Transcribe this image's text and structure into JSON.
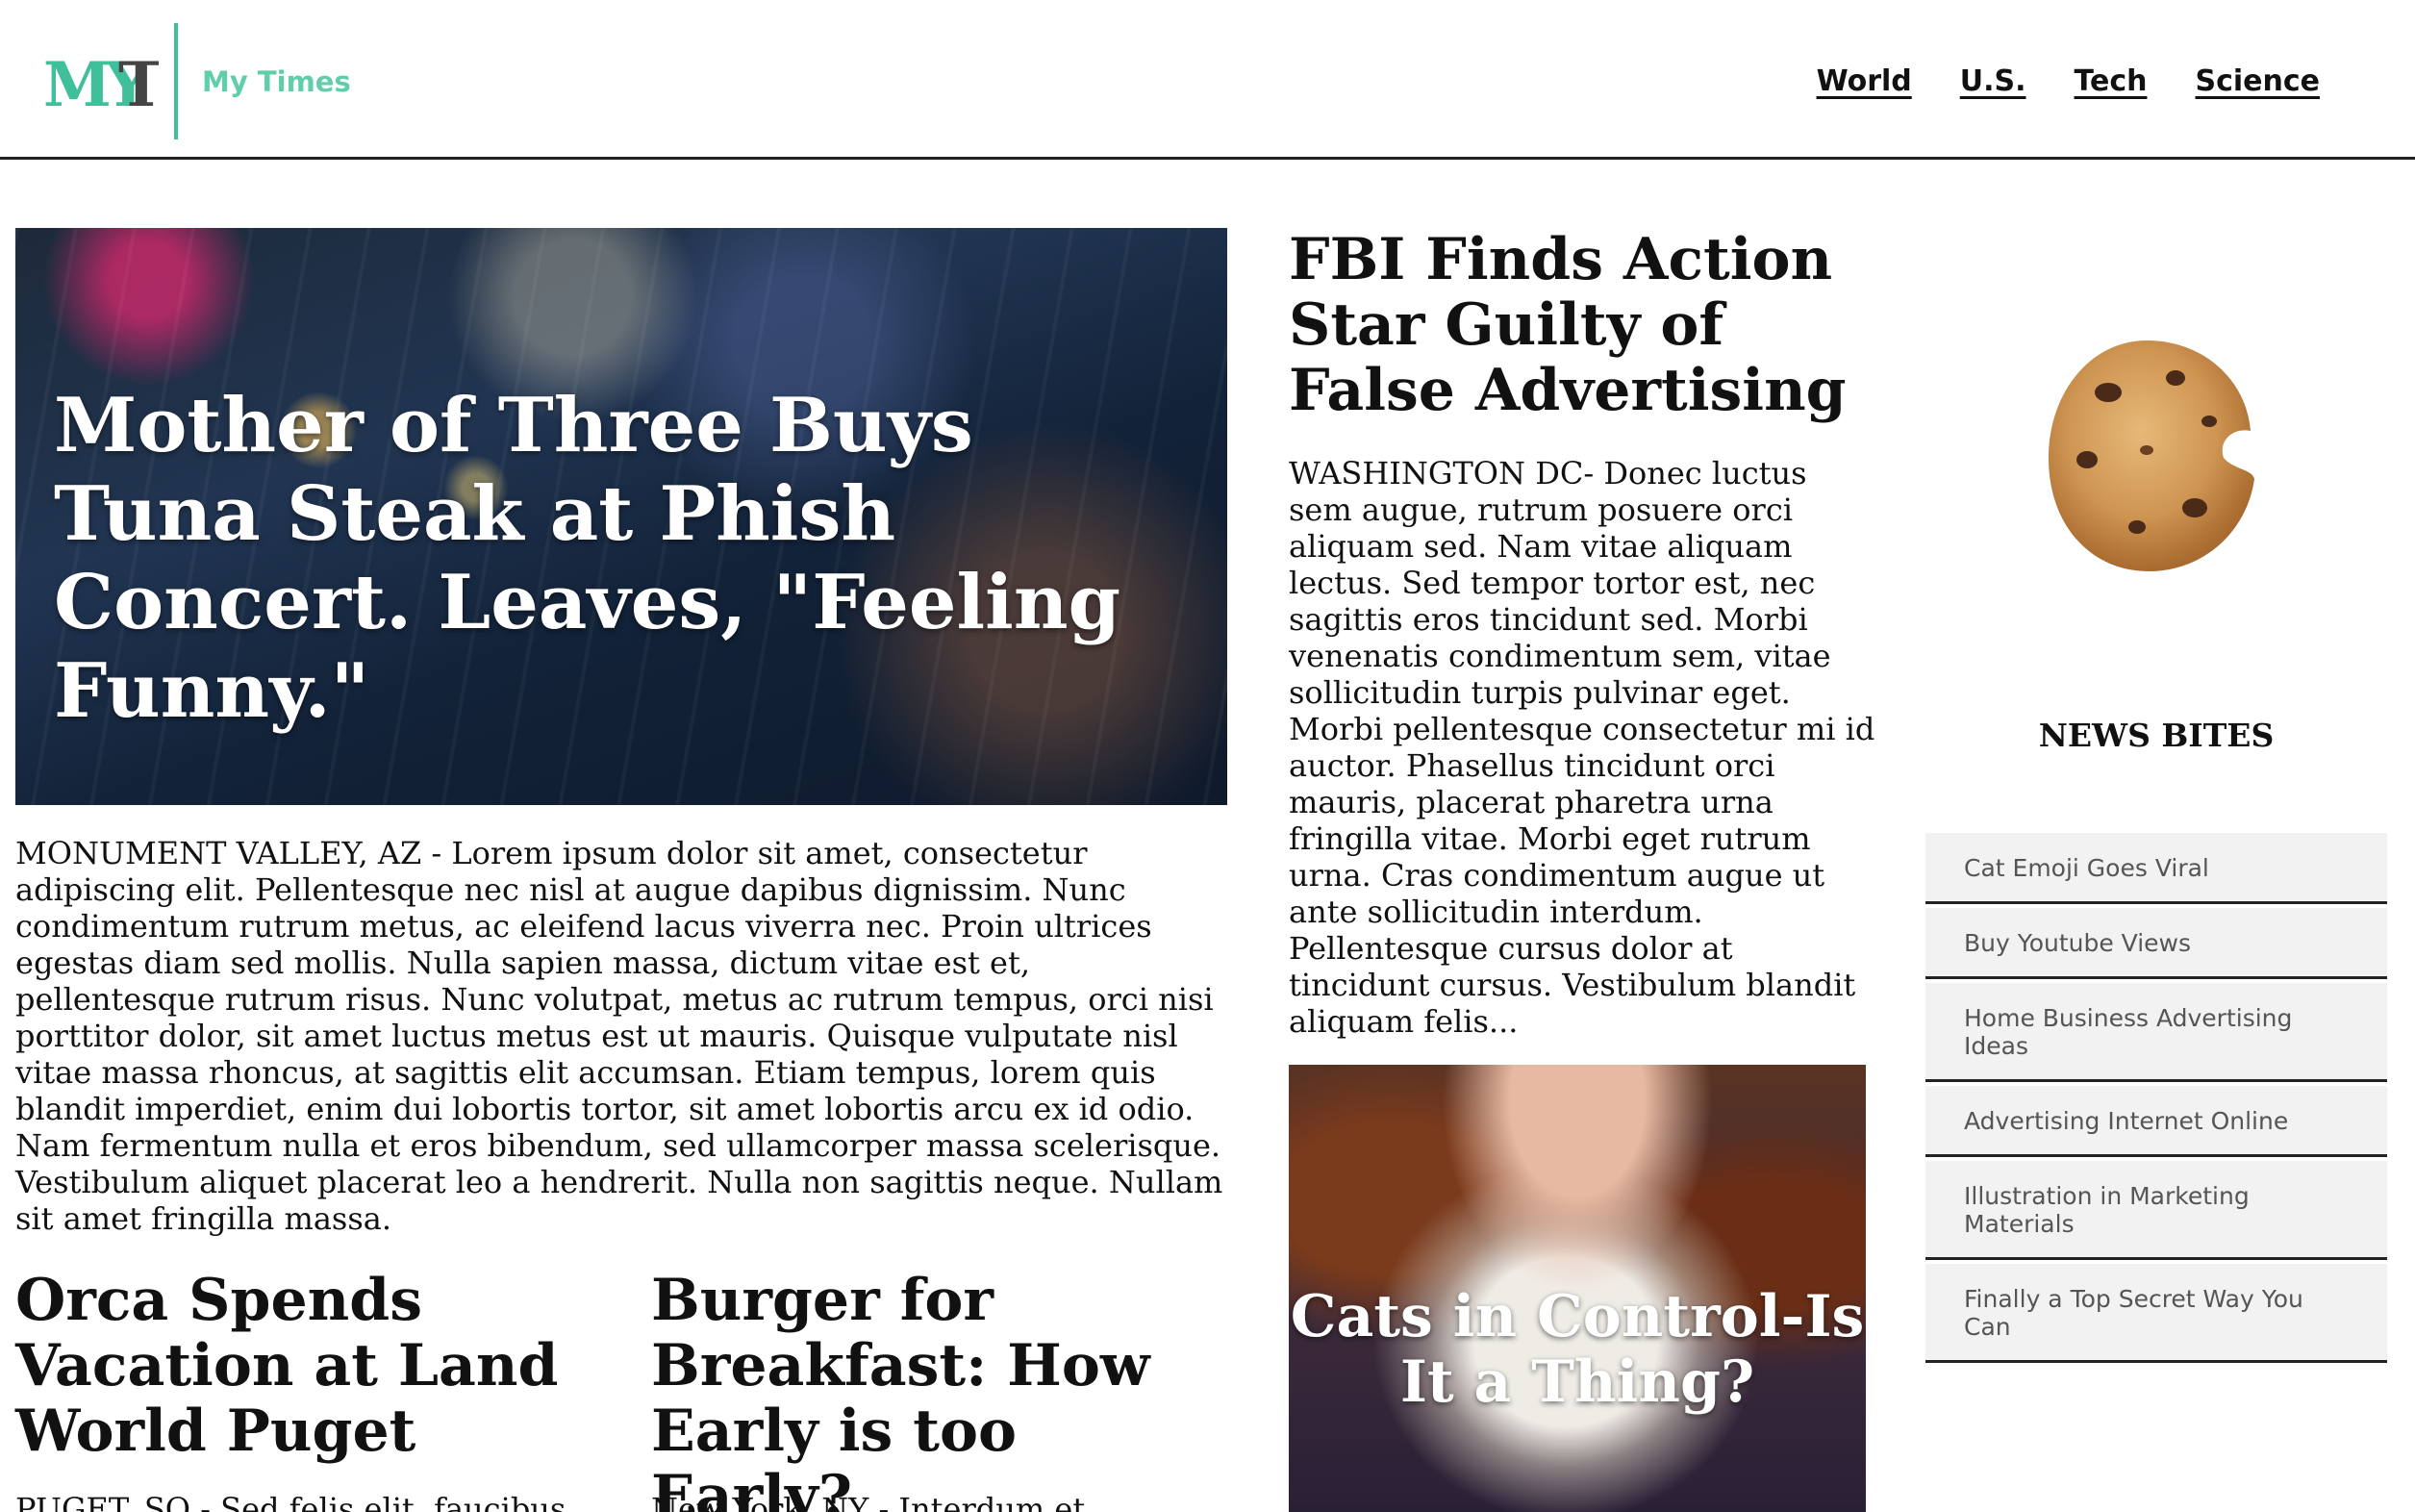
{
  "header": {
    "logo_text": "MYT",
    "brand": "My Times",
    "nav": [
      "World",
      "U.S.",
      "Tech",
      "Science"
    ]
  },
  "hero": {
    "title": "Mother of Three Buys Tuna Steak at Phish Concert. Leaves, \"Feeling Funny.\"",
    "body": "MONUMENT VALLEY, AZ - Lorem ipsum dolor sit amet, consectetur adipiscing elit. Pellentesque nec nisl at augue dapibus dignissim. Nunc condimentum rutrum metus, ac eleifend lacus viverra nec. Proin ultrices egestas diam sed mollis. Nulla sapien massa, dictum vitae est et, pellentesque rutrum risus. Nunc volutpat, metus ac rutrum tempus, orci nisi porttitor dolor, sit amet luctus metus est ut mauris. Quisque vulputate nisl vitae massa rhoncus, at sagittis elit accumsan. Etiam tempus, lorem quis blandit imperdiet, enim dui lobortis tortor, sit amet lobortis arcu ex id odio. Nam fermentum nulla et eros bibendum, sed ullamcorper massa scelerisque. Vestibulum aliquet placerat leo a hendrerit. Nulla non sagittis neque. Nullam sit amet fringilla massa."
  },
  "orca": {
    "title": "Orca Spends Vacation at Land World Puget",
    "body": "PUGET, SO - Sed felis elit, faucibus et"
  },
  "burger": {
    "title": "Burger for Breakfast: How Early is too Early?",
    "body": "New York, NY - Interdum et"
  },
  "fbi": {
    "title": "FBI Finds Action Star Guilty of False Advertising",
    "body": "WASHINGTON DC- Donec luctus sem augue, rutrum posuere orci aliquam sed. Nam vitae aliquam lectus. Sed tempor tortor est, nec sagittis eros tincidunt sed. Morbi venenatis condimentum sem, vitae sollicitudin turpis pulvinar eget. Morbi pellentesque consectetur mi id auctor. Phasellus tincidunt orci mauris, placerat pharetra urna fringilla vitae. Morbi eget rutrum urna. Cras condimentum augue ut ante sollicitudin interdum. Pellentesque cursus dolor at tincidunt cursus. Vestibulum blandit aliquam felis..."
  },
  "cats": {
    "title": "Cats in Control-Is It a Thing?"
  },
  "news_bites": {
    "title": "NEWS BITES",
    "items": [
      "Cat Emoji Goes Viral",
      "Buy Youtube Views",
      "Home Business Advertising Ideas",
      "Advertising Internet Online",
      "Illustration in Marketing Materials",
      "Finally a Top Secret Way You Can"
    ]
  },
  "colors": {
    "brand_accent": "#5fcfa9",
    "logo_teal": "#3fbf9a",
    "text": "#111111",
    "sidebar_bg": "#f2f2f2"
  },
  "icons": {
    "logo": "myt-logo",
    "cookie": "bitten-cookie-image"
  }
}
